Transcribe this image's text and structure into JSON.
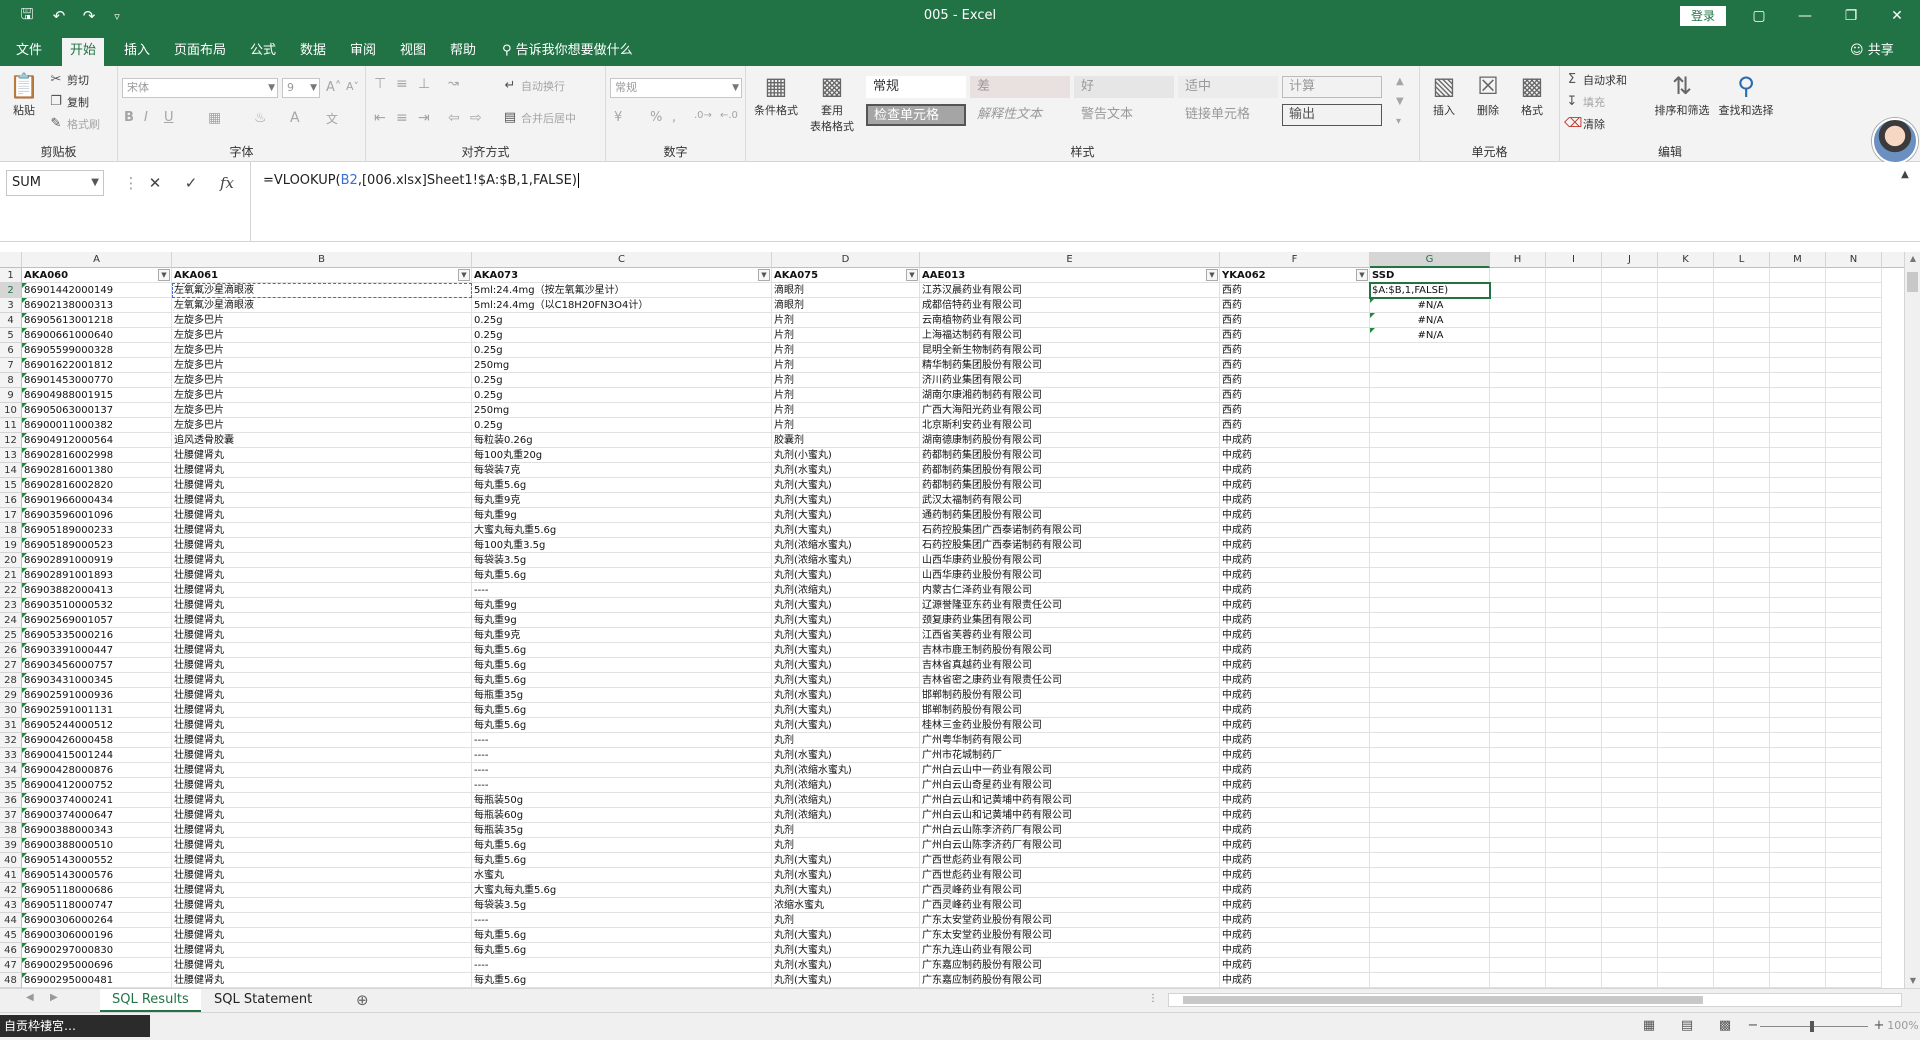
{
  "titlebar": {
    "title": "005  -  Excel",
    "login": "登录",
    "qa_icons": [
      "save-icon",
      "undo-icon",
      "redo-icon",
      "customize-icon"
    ]
  },
  "menubar": {
    "tabs": [
      "文件",
      "开始",
      "插入",
      "页面布局",
      "公式",
      "数据",
      "审阅",
      "视图",
      "帮助"
    ],
    "active": "开始",
    "tell_me": "告诉我你想要做什么",
    "share": "共享"
  },
  "ribbon": {
    "clipboard": {
      "label": "剪贴板",
      "paste": "粘贴",
      "cut": "剪切",
      "copy": "复制",
      "format_painter": "格式刷"
    },
    "font": {
      "label": "字体",
      "font_name": "宋体",
      "font_size": "9",
      "bold": "B",
      "italic": "I",
      "underline": "U"
    },
    "alignment": {
      "label": "对齐方式",
      "wrap": "自动换行",
      "merge": "合并后居中"
    },
    "number": {
      "label": "数字",
      "format": "常规"
    },
    "styles": {
      "label": "样式",
      "cond_format": "条件格式",
      "table_format": "套用\n表格格式",
      "cells_row1": [
        "常规",
        "差",
        "好",
        "适中",
        "计算"
      ],
      "cells_row2": [
        "检查单元格",
        "解释性文本",
        "警告文本",
        "链接单元格",
        "输出"
      ]
    },
    "cells": {
      "label": "单元格",
      "insert": "插入",
      "delete": "删除",
      "format": "格式"
    },
    "editing": {
      "label": "编辑",
      "autosum": "自动求和",
      "fill": "填充",
      "clear": "清除",
      "sort_filter": "排序和筛选",
      "find_select": "查找和选择"
    }
  },
  "formulabar": {
    "namebox": "SUM",
    "formula_prefix": "=VLOOKUP(",
    "formula_ref": "B2",
    "formula_rest": ",[006.xlsx]Sheet1!$A:$B,1,FALSE)"
  },
  "columns": [
    {
      "letter": "A"
    },
    {
      "letter": "B"
    },
    {
      "letter": "C"
    },
    {
      "letter": "D"
    },
    {
      "letter": "E"
    },
    {
      "letter": "F"
    },
    {
      "letter": "G"
    },
    {
      "letter": "H"
    },
    {
      "letter": "I"
    },
    {
      "letter": "J"
    },
    {
      "letter": "K"
    },
    {
      "letter": "L"
    },
    {
      "letter": "M"
    },
    {
      "letter": "N"
    }
  ],
  "header_row": [
    "AKA060",
    "AKA061",
    "AKA073",
    "AKA075",
    "AAE013",
    "YKA062",
    "SSD"
  ],
  "rows": [
    [
      "86901442000149",
      "左氧氟沙星滴眼液",
      "5ml:24.4mg（按左氧氟沙星计）",
      "滴眼剂",
      "江苏汉晨药业有限公司",
      "西药",
      "$A:$B,1,FALSE)"
    ],
    [
      "86902138000313",
      "左氧氟沙星滴眼液",
      "5ml:24.4mg（以C18H20FN3O4计）",
      "滴眼剂",
      "成都倍特药业有限公司",
      "西药",
      "#N/A"
    ],
    [
      "86905613001218",
      "左旋多巴片",
      "0.25g",
      "片剂",
      "云南植物药业有限公司",
      "西药",
      "#N/A"
    ],
    [
      "86900661000640",
      "左旋多巴片",
      "0.25g",
      "片剂",
      "上海福达制药有限公司",
      "西药",
      "#N/A"
    ],
    [
      "86905599000328",
      "左旋多巴片",
      "0.25g",
      "片剂",
      "昆明全新生物制药有限公司",
      "西药",
      ""
    ],
    [
      "86901622001812",
      "左旋多巴片",
      "250mg",
      "片剂",
      "精华制药集团股份有限公司",
      "西药",
      ""
    ],
    [
      "86901453000770",
      "左旋多巴片",
      "0.25g",
      "片剂",
      "济川药业集团有限公司",
      "西药",
      ""
    ],
    [
      "86904988001915",
      "左旋多巴片",
      "0.25g",
      "片剂",
      "湖南尔康湘药制药有限公司",
      "西药",
      ""
    ],
    [
      "86905063000137",
      "左旋多巴片",
      "250mg",
      "片剂",
      "广西大海阳光药业有限公司",
      "西药",
      ""
    ],
    [
      "86900011000382",
      "左旋多巴片",
      "0.25g",
      "片剂",
      "北京斯利安药业有限公司",
      "西药",
      ""
    ],
    [
      "86904912000564",
      "追风透骨胶囊",
      "每粒装0.26g",
      "胶囊剂",
      "湖南德康制药股份有限公司",
      "中成药",
      ""
    ],
    [
      "86902816002998",
      "壮腰健肾丸",
      "每100丸重20g",
      "丸剂(小蜜丸)",
      "药都制药集团股份有限公司",
      "中成药",
      ""
    ],
    [
      "86902816001380",
      "壮腰健肾丸",
      "每袋装7克",
      "丸剂(水蜜丸)",
      "药都制药集团股份有限公司",
      "中成药",
      ""
    ],
    [
      "86902816002820",
      "壮腰健肾丸",
      "每丸重5.6g",
      "丸剂(大蜜丸)",
      "药都制药集团股份有限公司",
      "中成药",
      ""
    ],
    [
      "86901966000434",
      "壮腰健肾丸",
      "每丸重9克",
      "丸剂(大蜜丸)",
      "武汉太福制药有限公司",
      "中成药",
      ""
    ],
    [
      "86903596001096",
      "壮腰健肾丸",
      "每丸重9g",
      "丸剂(大蜜丸)",
      "通药制药集团股份有限公司",
      "中成药",
      ""
    ],
    [
      "86905189000233",
      "壮腰健肾丸",
      "大蜜丸每丸重5.6g",
      "丸剂(大蜜丸)",
      "石药控股集团广西泰诺制药有限公司",
      "中成药",
      ""
    ],
    [
      "86905189000523",
      "壮腰健肾丸",
      "每100丸重3.5g",
      "丸剂(浓缩水蜜丸)",
      "石药控股集团广西泰诺制药有限公司",
      "中成药",
      ""
    ],
    [
      "86902891000919",
      "壮腰健肾丸",
      "每袋装3.5g",
      "丸剂(浓缩水蜜丸)",
      "山西华康药业股份有限公司",
      "中成药",
      ""
    ],
    [
      "86902891001893",
      "壮腰健肾丸",
      "每丸重5.6g",
      "丸剂(大蜜丸)",
      "山西华康药业股份有限公司",
      "中成药",
      ""
    ],
    [
      "86903882000413",
      "壮腰健肾丸",
      "----",
      "丸剂(浓缩丸)",
      "内蒙古仁泽药业有限公司",
      "中成药",
      ""
    ],
    [
      "86903510000532",
      "壮腰健肾丸",
      "每丸重9g",
      "丸剂(大蜜丸)",
      "辽源誉隆亚东药业有限责任公司",
      "中成药",
      ""
    ],
    [
      "86902569001057",
      "壮腰健肾丸",
      "每丸重9g",
      "丸剂(大蜜丸)",
      "颈复康药业集团有限公司",
      "中成药",
      ""
    ],
    [
      "86905335000216",
      "壮腰健肾丸",
      "每丸重9克",
      "丸剂(大蜜丸)",
      "江西省芙蓉药业有限公司",
      "中成药",
      ""
    ],
    [
      "86903391000447",
      "壮腰健肾丸",
      "每丸重5.6g",
      "丸剂(大蜜丸)",
      "吉林市鹿王制药股份有限公司",
      "中成药",
      ""
    ],
    [
      "86903456000757",
      "壮腰健肾丸",
      "每丸重5.6g",
      "丸剂(大蜜丸)",
      "吉林省真越药业有限公司",
      "中成药",
      ""
    ],
    [
      "86903431000345",
      "壮腰健肾丸",
      "每丸重5.6g",
      "丸剂(大蜜丸)",
      "吉林省密之康药业有限责任公司",
      "中成药",
      ""
    ],
    [
      "86902591000936",
      "壮腰健肾丸",
      "每瓶重35g",
      "丸剂(水蜜丸)",
      "邯郸制药股份有限公司",
      "中成药",
      ""
    ],
    [
      "86902591001131",
      "壮腰健肾丸",
      "每丸重5.6g",
      "丸剂(大蜜丸)",
      "邯郸制药股份有限公司",
      "中成药",
      ""
    ],
    [
      "86905244000512",
      "壮腰健肾丸",
      "每丸重5.6g",
      "丸剂(大蜜丸)",
      "桂林三金药业股份有限公司",
      "中成药",
      ""
    ],
    [
      "86900426000458",
      "壮腰健肾丸",
      "----",
      "丸剂",
      "广州粤华制药有限公司",
      "中成药",
      ""
    ],
    [
      "86900415001244",
      "壮腰健肾丸",
      "----",
      "丸剂(水蜜丸)",
      "广州市花城制药厂",
      "中成药",
      ""
    ],
    [
      "86900428000876",
      "壮腰健肾丸",
      "----",
      "丸剂(浓缩水蜜丸)",
      "广州白云山中一药业有限公司",
      "中成药",
      ""
    ],
    [
      "86900412000752",
      "壮腰健肾丸",
      "----",
      "丸剂(浓缩丸)",
      "广州白云山奇星药业有限公司",
      "中成药",
      ""
    ],
    [
      "86900374000241",
      "壮腰健肾丸",
      "每瓶装50g",
      "丸剂(浓缩丸)",
      "广州白云山和记黄埔中药有限公司",
      "中成药",
      ""
    ],
    [
      "86900374000647",
      "壮腰健肾丸",
      "每瓶装60g",
      "丸剂(浓缩丸)",
      "广州白云山和记黄埔中药有限公司",
      "中成药",
      ""
    ],
    [
      "86900388000343",
      "壮腰健肾丸",
      "每瓶装35g",
      "丸剂",
      "广州白云山陈李济药厂有限公司",
      "中成药",
      ""
    ],
    [
      "86900388000510",
      "壮腰健肾丸",
      "每丸重5.6g",
      "丸剂",
      "广州白云山陈李济药厂有限公司",
      "中成药",
      ""
    ],
    [
      "86905143000552",
      "壮腰健肾丸",
      "每丸重5.6g",
      "丸剂(大蜜丸)",
      "广西世彪药业有限公司",
      "中成药",
      ""
    ],
    [
      "86905143000576",
      "壮腰健肾丸",
      "水蜜丸",
      "丸剂(水蜜丸)",
      "广西世彪药业有限公司",
      "中成药",
      ""
    ],
    [
      "86905118000686",
      "壮腰健肾丸",
      "大蜜丸每丸重5.6g",
      "丸剂(大蜜丸)",
      "广西灵峰药业有限公司",
      "中成药",
      ""
    ],
    [
      "86905118000747",
      "壮腰健肾丸",
      "每袋装3.5g",
      "浓缩水蜜丸",
      "广西灵峰药业有限公司",
      "中成药",
      ""
    ],
    [
      "86900306000264",
      "壮腰健肾丸",
      "----",
      "丸剂",
      "广东太安堂药业股份有限公司",
      "中成药",
      ""
    ],
    [
      "86900306000196",
      "壮腰健肾丸",
      "每丸重5.6g",
      "丸剂(大蜜丸)",
      "广东太安堂药业股份有限公司",
      "中成药",
      ""
    ],
    [
      "86900297000830",
      "壮腰健肾丸",
      "每丸重5.6g",
      "丸剂(大蜜丸)",
      "广东九连山药业有限公司",
      "中成药",
      ""
    ],
    [
      "86900295000696",
      "壮腰健肾丸",
      "----",
      "丸剂(水蜜丸)",
      "广东嘉应制药股份有限公司",
      "中成药",
      ""
    ],
    [
      "86900295000481",
      "壮腰健肾丸",
      "每丸重5.6g",
      "丸剂(大蜜丸)",
      "广东嘉应制药股份有限公司",
      "中成药",
      ""
    ]
  ],
  "sheets": {
    "tabs": [
      "SQL Results",
      "SQL Statement"
    ],
    "active": "SQL Results",
    "add": "⊕"
  },
  "status": {
    "taskbar_chip": "自贡枠褄宮…",
    "zoom": "100%"
  },
  "colors": {
    "accent": "#217346",
    "ref_blue": "#3a6fd8",
    "ref_red": "#c0392b"
  }
}
